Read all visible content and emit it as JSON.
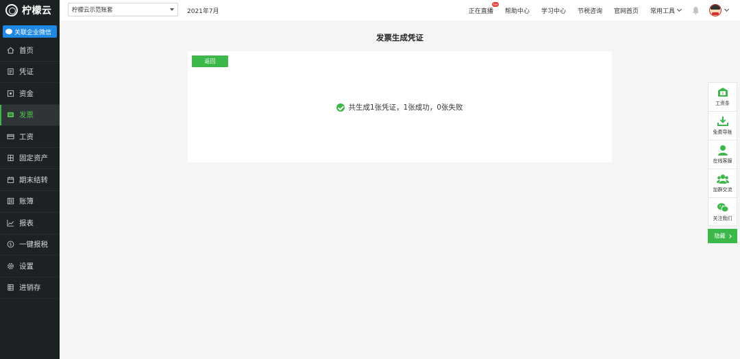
{
  "brand": {
    "name": "柠檬云"
  },
  "sidebar": {
    "wechat_button": "关联企业微信",
    "items": [
      {
        "label": "首页",
        "icon": "home-icon"
      },
      {
        "label": "凭证",
        "icon": "voucher-icon"
      },
      {
        "label": "资金",
        "icon": "fund-icon"
      },
      {
        "label": "发票",
        "icon": "invoice-icon",
        "active": true
      },
      {
        "label": "工资",
        "icon": "salary-icon"
      },
      {
        "label": "固定资产",
        "icon": "asset-icon"
      },
      {
        "label": "期末结转",
        "icon": "calendar-icon"
      },
      {
        "label": "账簿",
        "icon": "ledger-icon"
      },
      {
        "label": "报表",
        "icon": "chart-icon"
      },
      {
        "label": "一键报税",
        "icon": "tax-icon"
      },
      {
        "label": "设置",
        "icon": "gear-icon"
      },
      {
        "label": "进销存",
        "icon": "inventory-icon"
      }
    ]
  },
  "topbar": {
    "account": "柠檬云示范账套",
    "period": "2021年7月",
    "links": [
      "正在直播",
      "帮助中心",
      "学习中心",
      "节税咨询",
      "官网首页",
      "常用工具"
    ],
    "live_badge": "live"
  },
  "main": {
    "title": "发票生成凭证",
    "back_label": "返回",
    "result_text": "共生成1张凭证，1张成功，0张失败"
  },
  "float_tools": {
    "items": [
      {
        "label": "工资条",
        "icon": "payslip-icon"
      },
      {
        "label": "免费导账",
        "icon": "download-icon"
      },
      {
        "label": "在线客服",
        "icon": "support-icon"
      },
      {
        "label": "加群交流",
        "icon": "group-icon"
      },
      {
        "label": "关注我们",
        "icon": "wechat-icon"
      }
    ],
    "hide_label": "隐藏"
  },
  "colors": {
    "accent": "#3cb74a",
    "sidebar_bg": "#1c2223",
    "wechat_blue": "#1e88e5"
  }
}
